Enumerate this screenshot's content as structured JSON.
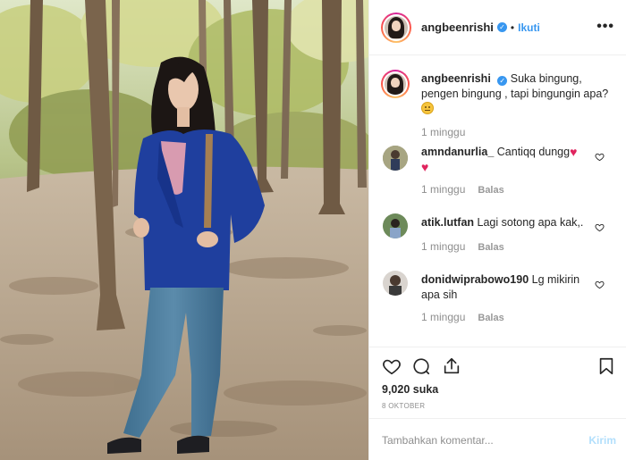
{
  "post": {
    "username": "angbeenrishi",
    "follow_label": "Ikuti",
    "separator": "•",
    "more_label": "•••",
    "caption": "Suka bingung, pengen bingung , tapi bingungin apa?",
    "caption_time": "1 minggu"
  },
  "comments": [
    {
      "user": "amndanurlia_",
      "text": "Cantiqq dungg",
      "time": "1 minggu",
      "reply": "Balas"
    },
    {
      "user": "atik.lutfan",
      "text": "Lagi sotong apa kak,.",
      "time": "1 minggu",
      "reply": "Balas"
    },
    {
      "user": "donidwiprabowo190",
      "text": "Lg mikirin apa sih",
      "time": "1 minggu",
      "reply": "Balas"
    }
  ],
  "stats": {
    "likes": "9,020 suka",
    "date": "8 OKTOBER"
  },
  "add_comment": {
    "placeholder": "Tambahkan komentar...",
    "post_label": "Kirim"
  },
  "colors": {
    "accent": "#3897f0",
    "post_disabled": "#b2dffc",
    "muted": "#8e8e8e",
    "heart": "#e0245e",
    "blazer": "#1f3f9e"
  },
  "icons": [
    "verified-icon",
    "more-options-icon",
    "heart-icon",
    "comment-icon",
    "share-icon",
    "bookmark-icon",
    "smile-emoji-icon"
  ]
}
